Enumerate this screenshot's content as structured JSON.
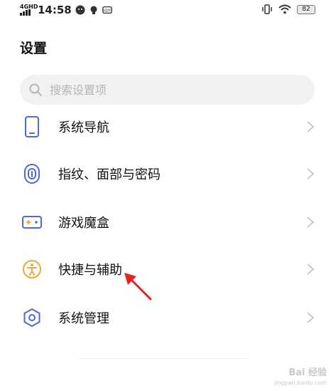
{
  "status_bar": {
    "network": "4GHD",
    "time": "14:58",
    "battery": "82",
    "icons": [
      "signal-icon",
      "wechat-icon",
      "bulb-icon",
      "iqiyi-icon",
      "vibrate-icon",
      "wifi-icon",
      "battery-icon"
    ]
  },
  "header": {
    "title": "设置"
  },
  "search": {
    "placeholder": "搜索设置项"
  },
  "items": [
    {
      "label": "系统导航",
      "icon": "phone-navigation-icon"
    },
    {
      "label": "指纹、面部与密码",
      "icon": "fingerprint-icon"
    },
    {
      "label": "游戏魔盒",
      "icon": "game-box-icon"
    },
    {
      "label": "快捷与辅助",
      "icon": "accessibility-icon"
    },
    {
      "label": "系统管理",
      "icon": "system-manage-icon"
    }
  ],
  "colors": {
    "accent_blue": "#4a6bd8",
    "accessibility_orange": "#f0a63a",
    "arrow_red": "#e8231f"
  },
  "watermark": {
    "text": "Bai 经验",
    "sub": "jingyan.baidu.com"
  }
}
